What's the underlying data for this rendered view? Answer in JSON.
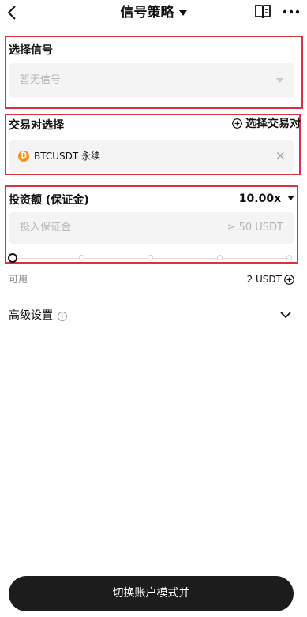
{
  "header": {
    "title": "信号策略",
    "icons": [
      "back-arrow-icon",
      "dropdown-triangle-icon",
      "book-icon",
      "more-icon"
    ]
  },
  "signal": {
    "label": "选择信号",
    "placeholder": "暂无信号"
  },
  "pair": {
    "label": "交易对选择",
    "add_label": "选择交易对",
    "coin_symbol": "₿",
    "selected": "BTCUSDT 永续"
  },
  "investment": {
    "label": "投资额 (保证金)",
    "leverage": "10.00x",
    "placeholder": "投入保证金",
    "min_hint": "≥ 50 USDT",
    "slider_level": 0,
    "available_label": "可用",
    "available_value": "2 USDT"
  },
  "advanced": {
    "label": "高级设置"
  },
  "footer": {
    "button_label": "切换账户模式并"
  },
  "colors": {
    "highlight_border": "#d9333f",
    "btc_orange": "#f7931a",
    "button_bg": "#1c1c1c"
  }
}
